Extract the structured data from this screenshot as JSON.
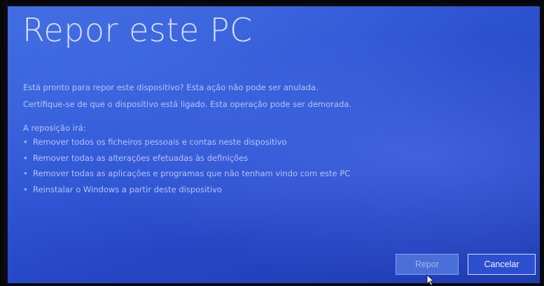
{
  "title": "Repor este PC",
  "message": {
    "line1": "Está pronto para repor este dispositivo? Esta ação não pode ser anulada.",
    "line2": "Certifique-se de que o dispositivo está ligado. Esta operação pode ser demorada."
  },
  "list_intro": "A reposição irá:",
  "bullet_char": "•",
  "bullets": [
    "Remover todos os ficheiros pessoais e contas neste dispositivo",
    "Remover todas as alterações efetuadas às definições",
    "Remover todas as aplicações e programas que não tenham vindo com este PC",
    "Reinstalar o Windows a partir deste dispositivo"
  ],
  "buttons": {
    "reset_label": "Repor",
    "cancel_label": "Cancelar"
  },
  "colors": {
    "background": "#2f56d4",
    "text": "#c8d6ff"
  }
}
